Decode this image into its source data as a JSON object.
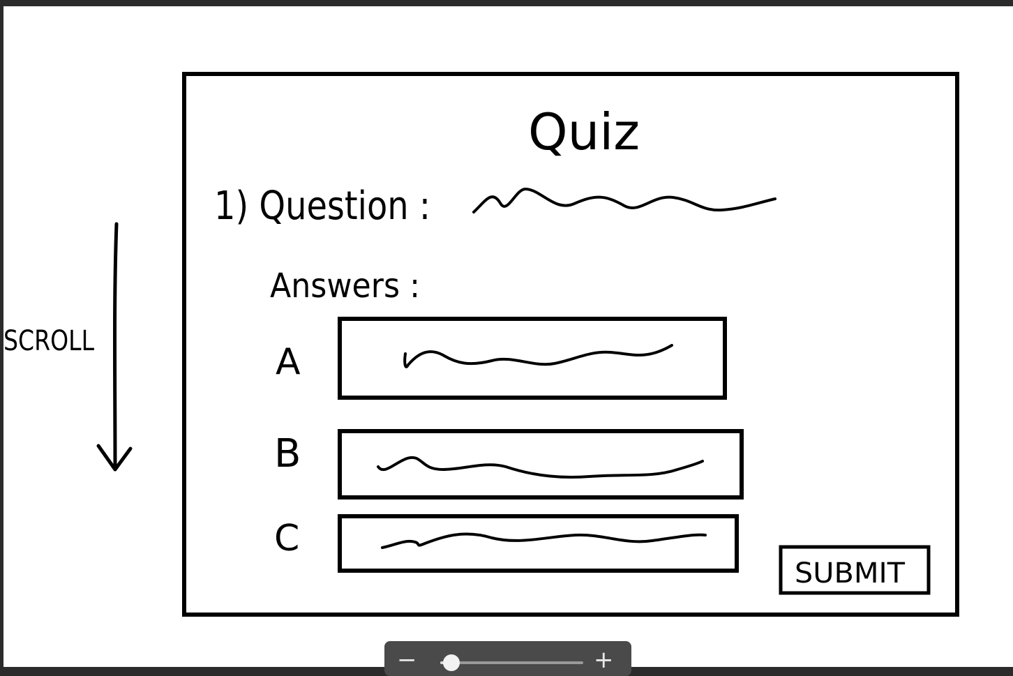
{
  "sketch": {
    "side_label": "SCROLL",
    "quiz_title": "Quiz",
    "question_label": "1) Question :",
    "answers_label": "Answers :",
    "options": [
      {
        "letter": "A"
      },
      {
        "letter": "B"
      },
      {
        "letter": "C"
      }
    ],
    "submit_label": "SUBMIT"
  },
  "zoom": {
    "minus_label": "−",
    "plus_label": "+",
    "level": 0.08
  }
}
